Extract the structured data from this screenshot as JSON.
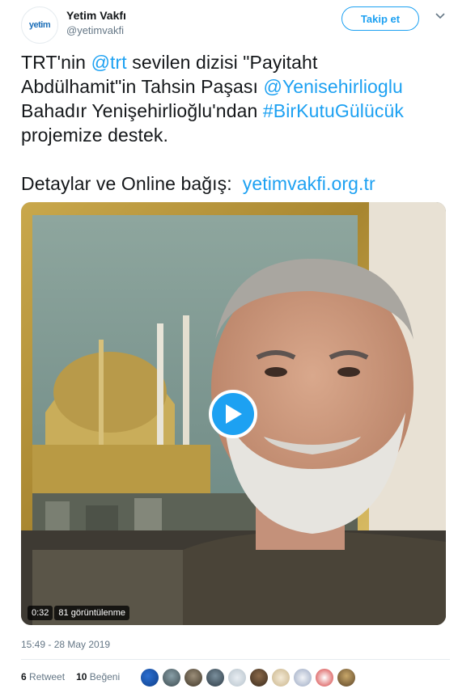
{
  "account": {
    "name": "Yetim Vakfı",
    "handle": "@yetimvakfi",
    "avatar_text": "yetim"
  },
  "follow_label": "Takip et",
  "tweet": {
    "line1_a": "TRT'nin ",
    "mention_trt": "@trt",
    "line1_b": " sevilen dizisi \"Payitaht",
    "line2_a": "Abdülhamit\"in Tahsin Paşası ",
    "mention_actor": "@Yenisehirlioglu",
    "line3_a": "Bahadır Yenişehirlioğlu'ndan ",
    "hashtag": "#BirKutuGülücük",
    "line4": "projemize destek.",
    "line5_a": "Detaylar ve Online bağış:  ",
    "link": "yetimvakfi.org.tr"
  },
  "video": {
    "duration": "0:32",
    "views": "81 görüntülenme"
  },
  "timestamp": "15:49 - 28 May 2019",
  "stats": {
    "retweets_count": "6",
    "retweets_label": "Retweet",
    "likes_count": "10",
    "likes_label": "Beğeni"
  },
  "colors": {
    "accent": "#1da1f2",
    "text": "#14171a",
    "muted": "#657786"
  }
}
